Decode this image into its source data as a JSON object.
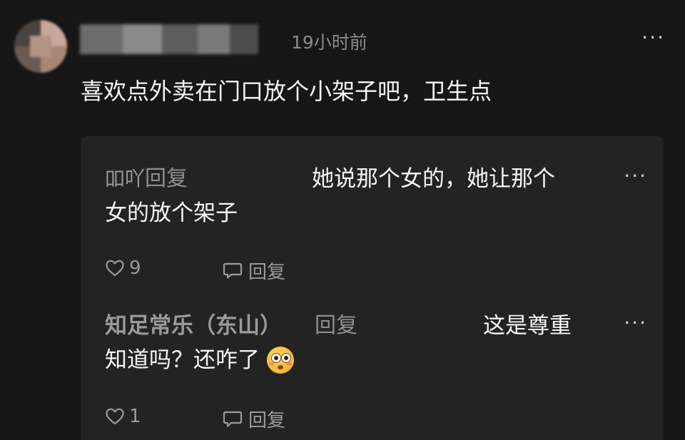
{
  "post": {
    "timestamp": "19小时前",
    "more": "···",
    "text": "喜欢点外卖在门口放个小架子吧，卫生点"
  },
  "replies": [
    {
      "user": "吅吖",
      "reply_label": "回复",
      "text_line1": "她说那个女的，她让那个",
      "text_line2": "女的放个架子",
      "more": "···",
      "likes": "9",
      "reply_action": "回复"
    },
    {
      "user": "知足常乐（东山）",
      "reply_label": "回复",
      "text_line1": "这是尊重",
      "text_line2": "知道吗？还咋了",
      "emoji": "flushed-face",
      "more": "···",
      "likes": "1",
      "reply_action": "回复"
    }
  ],
  "icons": {
    "like": "heart-outline-icon",
    "reply": "comment-bubble-icon",
    "more": "more-horizontal-icon"
  },
  "colors": {
    "background": "#161616",
    "reply_box": "#232323",
    "text": "#f5f5f5",
    "muted": "#9a9a9a"
  }
}
